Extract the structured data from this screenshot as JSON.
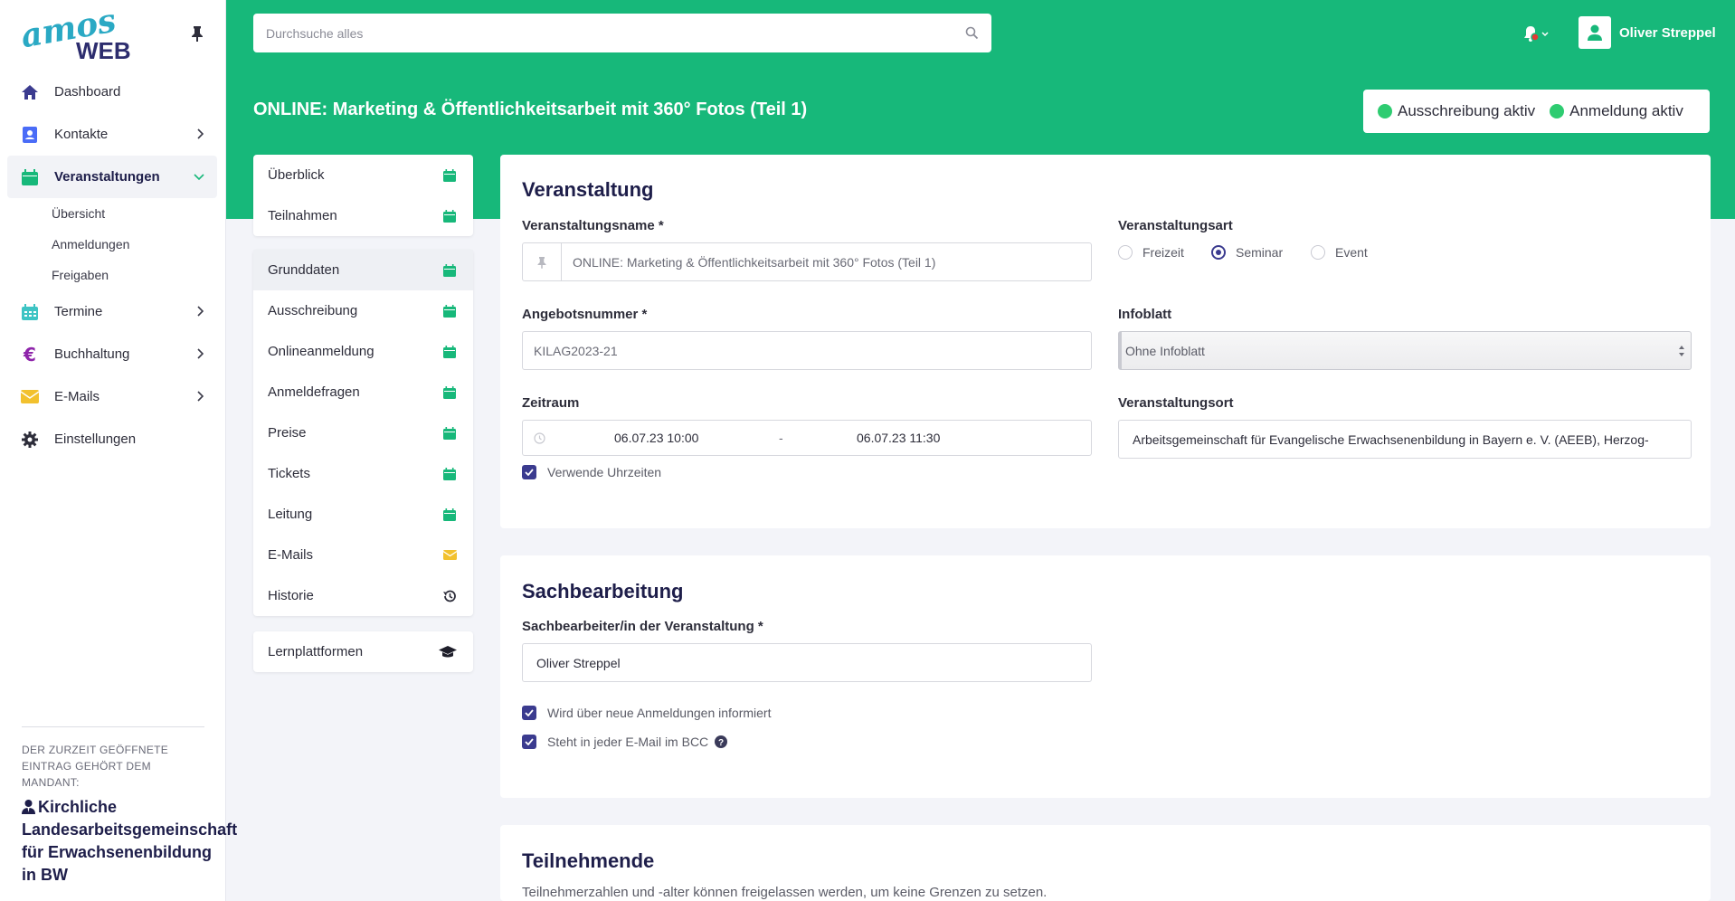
{
  "brand": {
    "name": "amos WEB",
    "accent": "#17b87a",
    "primary": "#3b3b8f"
  },
  "sidebar": {
    "items": [
      {
        "label": "Dashboard",
        "icon": "home-icon",
        "color": "#3b3b8f",
        "chevron": false
      },
      {
        "label": "Kontakte",
        "icon": "contact-book-icon",
        "color": "#4a6cf7",
        "chevron": "right"
      },
      {
        "label": "Veranstaltungen",
        "icon": "calendar-icon",
        "color": "#17b87a",
        "chevron": "down",
        "active": true
      },
      {
        "label": "Termine",
        "icon": "calendar-grid-icon",
        "color": "#3dc4c4",
        "chevron": "right"
      },
      {
        "label": "Buchhaltung",
        "icon": "euro-icon",
        "color": "#8e24aa",
        "chevron": "right"
      },
      {
        "label": "E-Mails",
        "icon": "envelope-icon",
        "color": "#f2c12e",
        "chevron": "right"
      },
      {
        "label": "Einstellungen",
        "icon": "gear-icon",
        "color": "#2d2d3a",
        "chevron": false
      }
    ],
    "sub_items": [
      "Übersicht",
      "Anmeldungen",
      "Freigaben"
    ],
    "mandant_caption": "Der zurzeit geöffnete Eintrag gehört dem Mandant:",
    "mandant_name": "Kirchliche Landesarbeitsgemeinschaft für Erwachsenenbildung in BW"
  },
  "header": {
    "search_placeholder": "Durchsuche alles",
    "user_name": "Oliver Streppel",
    "page_title": "ONLINE: Marketing & Öffentlichkeitsarbeit mit 360° Fotos (Teil 1)",
    "status": [
      {
        "label": "Ausschreibung aktiv",
        "color": "#2ecc71"
      },
      {
        "label": "Anmeldung aktiv",
        "color": "#2ecc71"
      }
    ]
  },
  "subnav": {
    "group1": [
      {
        "label": "Überblick",
        "icon": "calendar-icon"
      },
      {
        "label": "Teilnahmen",
        "icon": "calendar-icon"
      }
    ],
    "group2": [
      {
        "label": "Grunddaten",
        "icon": "calendar-icon",
        "active": true
      },
      {
        "label": "Ausschreibung",
        "icon": "calendar-icon"
      },
      {
        "label": "Onlineanmeldung",
        "icon": "calendar-icon"
      },
      {
        "label": "Anmeldefragen",
        "icon": "calendar-icon"
      },
      {
        "label": "Preise",
        "icon": "calendar-icon"
      },
      {
        "label": "Tickets",
        "icon": "calendar-icon"
      },
      {
        "label": "Leitung",
        "icon": "calendar-icon"
      },
      {
        "label": "E-Mails",
        "icon": "envelope-icon"
      },
      {
        "label": "Historie",
        "icon": "history-icon"
      }
    ],
    "group3": [
      {
        "label": "Lernplattformen",
        "icon": "graduation-cap-icon"
      }
    ]
  },
  "veranstaltung": {
    "title": "Veranstaltung",
    "name_label": "Veranstaltungsname *",
    "name_value": "ONLINE: Marketing & Öffentlichkeitsarbeit mit 360° Fotos (Teil 1)",
    "art_label": "Veranstaltungsart",
    "art_options": [
      "Freizeit",
      "Seminar",
      "Event"
    ],
    "art_selected": "Seminar",
    "angebot_label": "Angebotsnummer *",
    "angebot_value": "KILAG2023-21",
    "infoblatt_label": "Infoblatt",
    "infoblatt_value": "Ohne Infoblatt",
    "zeitraum_label": "Zeitraum",
    "zeitraum_start": "06.07.23 10:00",
    "zeitraum_sep": "-",
    "zeitraum_end": "06.07.23 11:30",
    "uhrzeiten_label": "Verwende Uhrzeiten",
    "ort_label": "Veranstaltungsort",
    "ort_value": "Arbeitsgemeinschaft für Evangelische Erwachsenenbildung in Bayern e. V. (AEEB), Herzog-"
  },
  "sachbearbeitung": {
    "title": "Sachbearbeitung",
    "label": "Sachbearbeiter/in der Veranstaltung *",
    "value": "Oliver Streppel",
    "check1": "Wird über neue Anmeldungen informiert",
    "check2": "Steht in jeder E-Mail im BCC"
  },
  "teilnehmende": {
    "title": "Teilnehmende",
    "desc": "Teilnehmerzahlen und -alter können freigelassen werden, um keine Grenzen zu setzen."
  }
}
